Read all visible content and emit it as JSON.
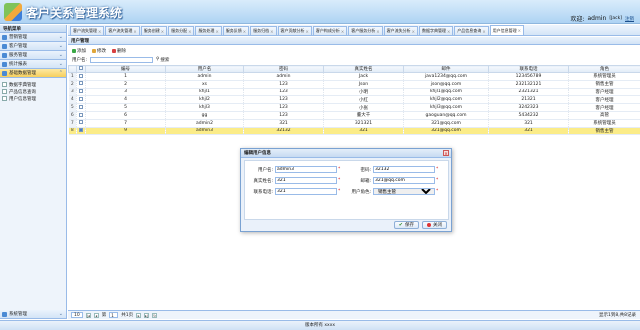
{
  "header": {
    "title": "客户关系管理系统",
    "welcome_label": "欢迎:",
    "user": "admin",
    "user_bracket": "[Jack]",
    "logout": "注销"
  },
  "sidebar": {
    "title": "导航菜单",
    "items": [
      {
        "label": "营销管理"
      },
      {
        "label": "客户管理"
      },
      {
        "label": "服务管理"
      },
      {
        "label": "统计报表"
      },
      {
        "label": "基础数据管理"
      }
    ],
    "sub_items": [
      {
        "label": "数据字典管理"
      },
      {
        "label": "产品信息查询"
      },
      {
        "label": "用户信息管理"
      }
    ],
    "bottom": {
      "label": "系统管理"
    }
  },
  "tabs": [
    {
      "label": "客户流失管理"
    },
    {
      "label": "客户流失管理"
    },
    {
      "label": "服务创建"
    },
    {
      "label": "服务分配"
    },
    {
      "label": "服务处理"
    },
    {
      "label": "服务反馈"
    },
    {
      "label": "服务归档"
    },
    {
      "label": "客户贡献分析"
    },
    {
      "label": "客户构成分析"
    },
    {
      "label": "客户服务分析"
    },
    {
      "label": "客户流失分析"
    },
    {
      "label": "数据字典管理"
    },
    {
      "label": "产品信息查询"
    },
    {
      "label": "用户信息管理"
    }
  ],
  "panel": {
    "title": "用户管理"
  },
  "toolbar": {
    "add": "添加",
    "edit": "修改",
    "delete": "删除"
  },
  "search": {
    "label": "用户名:",
    "button": "搜索"
  },
  "table": {
    "columns": [
      "",
      "",
      "编号",
      "用户名",
      "密码",
      "真实姓名",
      "邮件",
      "联系电话",
      "角色"
    ],
    "rows": [
      {
        "n": "1",
        "id": "1",
        "user": "admin",
        "pwd": "admin",
        "name": "Jack",
        "mail": "java1234@qq.com",
        "phone": "123456789",
        "role": "系统管理员"
      },
      {
        "n": "2",
        "id": "2",
        "user": "xs",
        "pwd": "123",
        "name": "Json",
        "mail": "json@qq.com",
        "phone": "232132121",
        "role": "销售主管"
      },
      {
        "n": "3",
        "id": "3",
        "user": "khjl1",
        "pwd": "123",
        "name": "小明",
        "mail": "khjl1@qq.com",
        "phone": "2321321",
        "role": "客户经理"
      },
      {
        "n": "4",
        "id": "4",
        "user": "khjl2",
        "pwd": "123",
        "name": "小红",
        "mail": "khjl2@qq.com",
        "phone": "21321",
        "role": "客户经理"
      },
      {
        "n": "5",
        "id": "5",
        "user": "khjl3",
        "pwd": "123",
        "name": "小张",
        "mail": "khjl3@qq.com",
        "phone": "3242323",
        "role": "客户经理"
      },
      {
        "n": "6",
        "id": "6",
        "user": "gg",
        "pwd": "123",
        "name": "董大千",
        "mail": "gaoguan@qq.com",
        "phone": "5434232",
        "role": "高管"
      },
      {
        "n": "7",
        "id": "7",
        "user": "admin2",
        "pwd": "321",
        "name": "321321",
        "mail": "321@qq.com",
        "phone": "321",
        "role": "系统管理员"
      },
      {
        "n": "8",
        "id": "9",
        "user": "admin3",
        "pwd": "32132",
        "name": "321",
        "mail": "321@qq.com",
        "phone": "321",
        "role": "销售主管"
      }
    ]
  },
  "pager": {
    "page_size": "10",
    "page": "1",
    "of": "共1页",
    "info": "显示1到8,共8记录"
  },
  "dialog": {
    "title": "编辑用户信息",
    "fields": {
      "username": {
        "label": "用户名:",
        "value": "admin3"
      },
      "password": {
        "label": "密码:",
        "value": "32132"
      },
      "realname": {
        "label": "真实姓名:",
        "value": "321"
      },
      "email": {
        "label": "邮箱:",
        "value": "321@qq.com"
      },
      "phone": {
        "label": "联系电话:",
        "value": "321"
      },
      "role": {
        "label": "用户角色:",
        "value": "销售主管"
      }
    },
    "required_mark": "*",
    "save": "保存",
    "close": "关闭"
  },
  "footer": {
    "text": "版本所有 xxxx"
  }
}
